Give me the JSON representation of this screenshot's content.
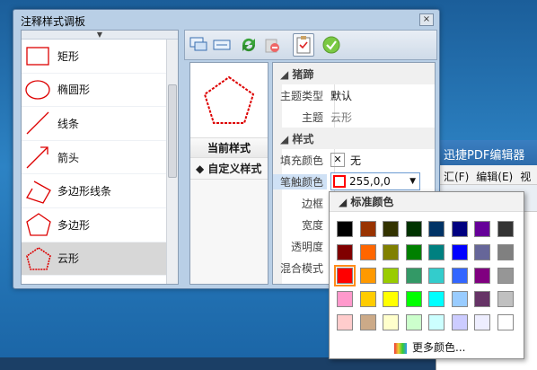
{
  "dialog": {
    "title": "注释样式调板",
    "close": "×"
  },
  "shapes": [
    {
      "label": "矩形",
      "icon": "rectangle-icon"
    },
    {
      "label": "椭圆形",
      "icon": "ellipse-icon"
    },
    {
      "label": "线条",
      "icon": "line-icon"
    },
    {
      "label": "箭头",
      "icon": "arrow-icon"
    },
    {
      "label": "多边形线条",
      "icon": "polyline-icon"
    },
    {
      "label": "多边形",
      "icon": "polygon-icon"
    },
    {
      "label": "云形",
      "icon": "cloud-polygon-icon"
    }
  ],
  "selected_shape": "云形",
  "toolbar": {
    "buttons": [
      "callout-icon",
      "textbox-icon",
      "refresh-icon",
      "delete-icon",
      "clipboard-icon",
      "check-icon"
    ]
  },
  "styles": {
    "current": "当前样式",
    "custom": "自定义样式",
    "preview_icon": "cloud-pentagon-icon"
  },
  "props": {
    "cat_stamp": "猪蹄",
    "theme_type_label": "主题类型",
    "theme_type_value": "默认",
    "theme_label": "主题",
    "theme_value": "云形",
    "cat_style": "样式",
    "fill_label": "填充颜色",
    "fill_value": "无",
    "stroke_label": "笔触颜色",
    "stroke_value": "255,0,0",
    "border_label": "边框",
    "width_label": "宽度",
    "opacity_label": "透明度",
    "blend_label": "混合模式"
  },
  "popup": {
    "header": "标准颜色",
    "more": "更多颜色...",
    "colors": [
      "#000000",
      "#993300",
      "#333300",
      "#003300",
      "#003366",
      "#000080",
      "#660099",
      "#333333",
      "#800000",
      "#ff6600",
      "#808000",
      "#008000",
      "#008080",
      "#0000ff",
      "#666699",
      "#808080",
      "#ff0000",
      "#ff9900",
      "#99cc00",
      "#339966",
      "#33cccc",
      "#3366ff",
      "#800080",
      "#969696",
      "#ff99cc",
      "#ffcc00",
      "#ffff00",
      "#00ff00",
      "#00ffff",
      "#99ccff",
      "#663366",
      "#c0c0c0",
      "#ffcccc",
      "#ccaa88",
      "#ffffcc",
      "#ccffcc",
      "#ccffff",
      "#ccccff",
      "#eeeeff",
      "#ffffff"
    ],
    "selected": "#ff0000"
  },
  "bgapp": {
    "title": "迅捷PDF编辑器",
    "menu": [
      "汇(F)",
      "编辑(E)",
      "视"
    ]
  },
  "accent": "#ff0000"
}
